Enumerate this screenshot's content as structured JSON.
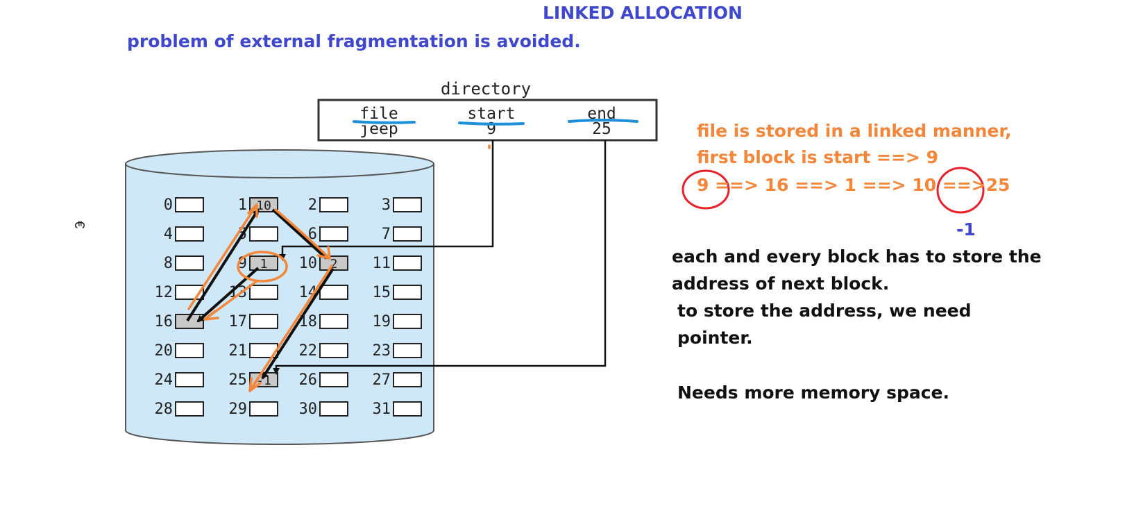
{
  "title": "LINKED ALLOCATION",
  "subtitle": "problem of external fragmentation is avoided.",
  "directory": {
    "caption": "directory",
    "headers": [
      "file",
      "start",
      "end"
    ],
    "row": [
      "jeep",
      "9",
      "25"
    ]
  },
  "disk": {
    "side_mark": "€",
    "blocks": [
      "0",
      "1",
      "2",
      "3",
      "4",
      "5",
      "6",
      "7",
      "8",
      "9",
      "10",
      "11",
      "12",
      "13",
      "14",
      "15",
      "16",
      "17",
      "18",
      "19",
      "20",
      "21",
      "22",
      "23",
      "24",
      "25",
      "26",
      "27",
      "28",
      "29",
      "30",
      "31"
    ],
    "filled_blocks": {
      "1": "10",
      "9": "1",
      "10": "2",
      "16": "",
      "25": "-1"
    }
  },
  "notes": {
    "orange_line_1": "file is stored in a linked manner,",
    "orange_line_2": "first block is start ==> 9",
    "orange_line_3": "9 ==> 16 ==> 1 ==> 10 ==>25",
    "minus_one": "-1",
    "black_line_1": "each and every block has to store the",
    "black_line_2": "address of next block.",
    "black_line_3": "to store the address, we need",
    "black_line_4": "pointer.",
    "black_line_5": "Needs more memory space."
  },
  "colors": {
    "heading_blue": "#3f48cc",
    "annotation_orange": "#f4863a",
    "cylinder_fill": "#cfe8f7",
    "circle_red": "#e8202a",
    "underline_blue": "#1e90d8",
    "filled_block": "#c9c9c9"
  }
}
